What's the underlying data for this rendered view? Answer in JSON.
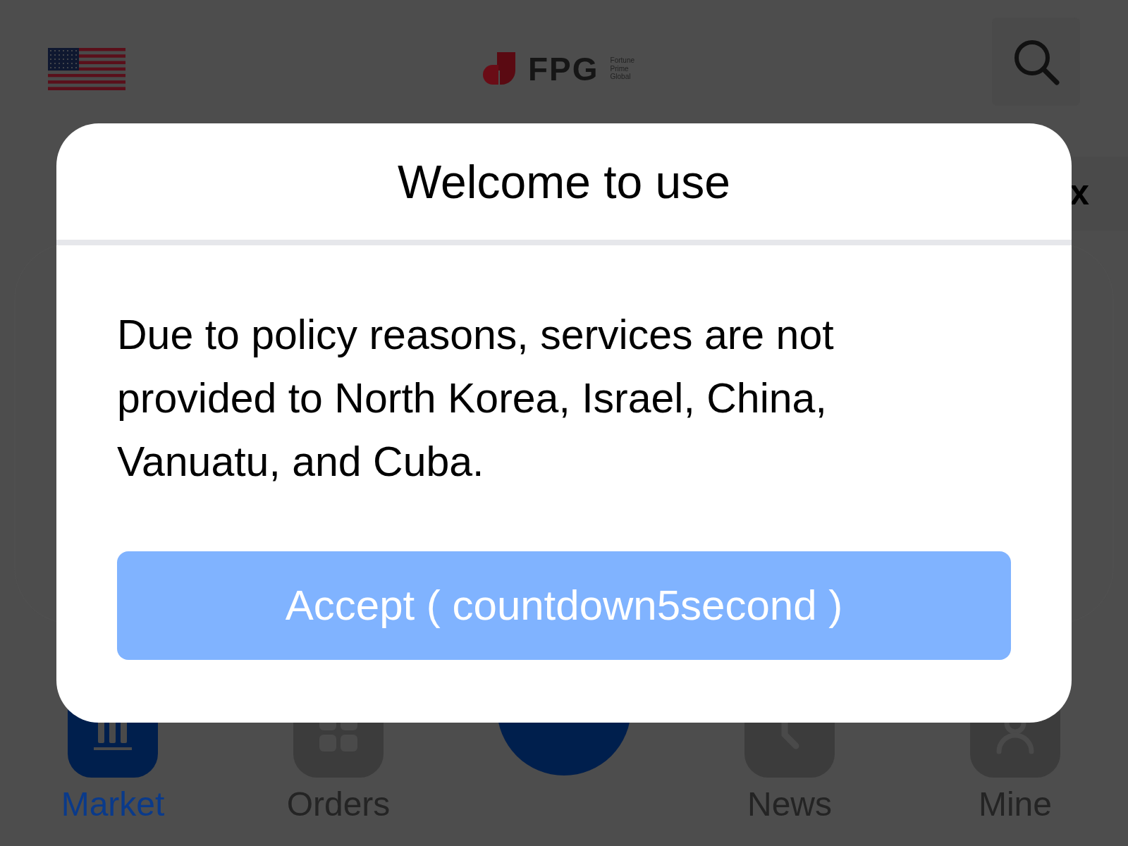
{
  "header": {
    "logo": {
      "wordmark": "FPG",
      "tagline": [
        "Fortune",
        "Prime",
        "Global"
      ]
    }
  },
  "behind_panel": {
    "close_label": "x"
  },
  "dialog": {
    "title": "Welcome to use",
    "message": "Due to policy reasons, services are not provided to North Korea, Israel, China, Vanuatu, and Cuba.",
    "button": {
      "label": "Accept ( countdown5second )",
      "disabled": true
    }
  },
  "tab_bar": [
    {
      "label": "Market",
      "kind": "market",
      "selected": true
    },
    {
      "label": "Orders",
      "kind": "orders",
      "selected": false
    },
    {
      "label": "News",
      "kind": "news",
      "selected": false
    },
    {
      "label": "Mine",
      "kind": "mine",
      "selected": false
    }
  ]
}
